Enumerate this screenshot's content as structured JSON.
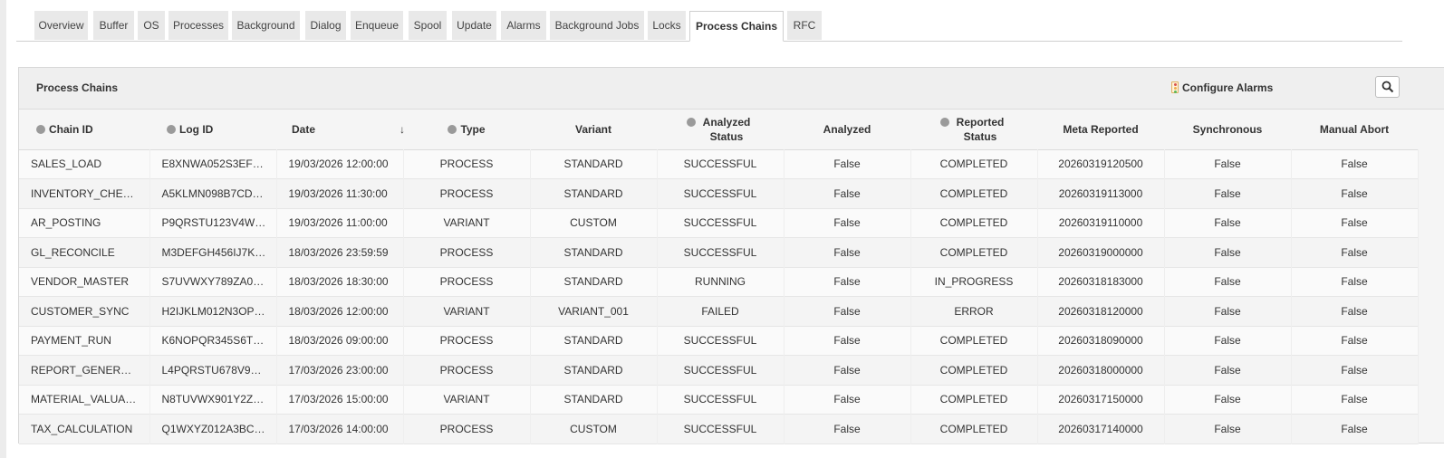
{
  "tabs": [
    {
      "label": "Overview",
      "active": false
    },
    {
      "label": "Buffer",
      "active": false
    },
    {
      "label": "OS",
      "active": false
    },
    {
      "label": "Processes",
      "active": false
    },
    {
      "label": "Background",
      "active": false
    },
    {
      "label": "Dialog",
      "active": false
    },
    {
      "label": "Enqueue",
      "active": false
    },
    {
      "label": "Spool",
      "active": false
    },
    {
      "label": "Update",
      "active": false
    },
    {
      "label": "Alarms",
      "active": false
    },
    {
      "label": "Background Jobs",
      "active": false
    },
    {
      "label": "Locks",
      "active": false
    },
    {
      "label": "Process Chains",
      "active": true
    },
    {
      "label": "RFC",
      "active": false
    }
  ],
  "panel": {
    "title": "Process Chains",
    "configure_label": "Configure Alarms",
    "search_icon": "search-icon"
  },
  "table": {
    "columns": [
      {
        "label": "Chain ID",
        "dot": true
      },
      {
        "label": "Log ID",
        "dot": true
      },
      {
        "label": "Date",
        "dot": false,
        "sort": "↓"
      },
      {
        "label": "Type",
        "dot": true
      },
      {
        "label": "Variant",
        "dot": false
      },
      {
        "label": "Analyzed Status",
        "dot": true
      },
      {
        "label": "Analyzed",
        "dot": false
      },
      {
        "label": "Reported Status",
        "dot": true
      },
      {
        "label": "Meta Reported",
        "dot": false
      },
      {
        "label": "Synchronous",
        "dot": false
      },
      {
        "label": "Manual Abort",
        "dot": false
      }
    ],
    "rows": [
      [
        "SALES_LOAD",
        "E8XNWA052S3EF…",
        "19/03/2026 12:00:00",
        "PROCESS",
        "STANDARD",
        "SUCCESSFUL",
        "False",
        "COMPLETED",
        "20260319120500",
        "False",
        "False"
      ],
      [
        "INVENTORY_CHE…",
        "A5KLMN098B7CD…",
        "19/03/2026 11:30:00",
        "PROCESS",
        "STANDARD",
        "SUCCESSFUL",
        "False",
        "COMPLETED",
        "20260319113000",
        "False",
        "False"
      ],
      [
        "AR_POSTING",
        "P9QRSTU123V4W…",
        "19/03/2026 11:00:00",
        "VARIANT",
        "CUSTOM",
        "SUCCESSFUL",
        "False",
        "COMPLETED",
        "20260319110000",
        "False",
        "False"
      ],
      [
        "GL_RECONCILE",
        "M3DEFGH456IJ7K…",
        "18/03/2026 23:59:59",
        "PROCESS",
        "STANDARD",
        "SUCCESSFUL",
        "False",
        "COMPLETED",
        "20260319000000",
        "False",
        "False"
      ],
      [
        "VENDOR_MASTER",
        "S7UVWXY789ZA0…",
        "18/03/2026 18:30:00",
        "PROCESS",
        "STANDARD",
        "RUNNING",
        "False",
        "IN_PROGRESS",
        "20260318183000",
        "False",
        "False"
      ],
      [
        "CUSTOMER_SYNC",
        "H2IJKLM012N3OP…",
        "18/03/2026 12:00:00",
        "VARIANT",
        "VARIANT_001",
        "FAILED",
        "False",
        "ERROR",
        "20260318120000",
        "False",
        "False"
      ],
      [
        "PAYMENT_RUN",
        "K6NOPQR345S6T…",
        "18/03/2026 09:00:00",
        "PROCESS",
        "STANDARD",
        "SUCCESSFUL",
        "False",
        "COMPLETED",
        "20260318090000",
        "False",
        "False"
      ],
      [
        "REPORT_GENER…",
        "L4PQRSTU678V9…",
        "17/03/2026 23:00:00",
        "PROCESS",
        "STANDARD",
        "SUCCESSFUL",
        "False",
        "COMPLETED",
        "20260318000000",
        "False",
        "False"
      ],
      [
        "MATERIAL_VALUA…",
        "N8TUVWX901Y2Z…",
        "17/03/2026 15:00:00",
        "VARIANT",
        "STANDARD",
        "SUCCESSFUL",
        "False",
        "COMPLETED",
        "20260317150000",
        "False",
        "False"
      ],
      [
        "TAX_CALCULATION",
        "Q1WXYZ012A3BC…",
        "17/03/2026 14:00:00",
        "PROCESS",
        "CUSTOM",
        "SUCCESSFUL",
        "False",
        "COMPLETED",
        "20260317140000",
        "False",
        "False"
      ]
    ]
  }
}
